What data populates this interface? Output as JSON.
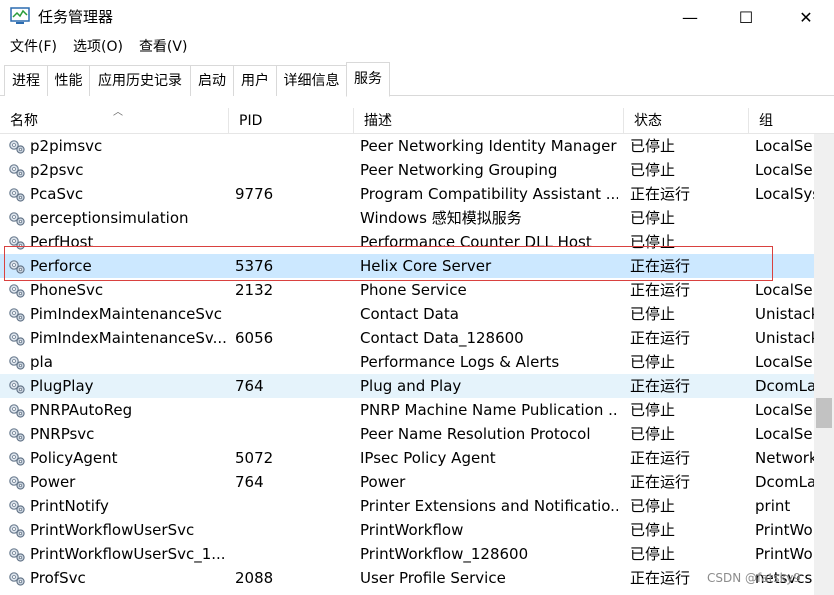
{
  "window": {
    "title": "任务管理器",
    "minimize": "—",
    "maximize": "☐",
    "close": "✕"
  },
  "menu": {
    "items": [
      "文件(F)",
      "选项(O)",
      "查看(V)"
    ]
  },
  "tabs": [
    "进程",
    "性能",
    "应用历史记录",
    "启动",
    "用户",
    "详细信息",
    "服务"
  ],
  "active_tab": "服务",
  "columns": {
    "name": "名称",
    "pid": "PID",
    "desc": "描述",
    "status": "状态",
    "group": "组"
  },
  "services": [
    {
      "name": "p2pimsvc",
      "pid": "",
      "desc": "Peer Networking Identity Manager",
      "status": "已停止",
      "group": "LocalSer"
    },
    {
      "name": "p2psvc",
      "pid": "",
      "desc": "Peer Networking Grouping",
      "status": "已停止",
      "group": "LocalSer"
    },
    {
      "name": "PcaSvc",
      "pid": "9776",
      "desc": "Program Compatibility Assistant ...",
      "status": "正在运行",
      "group": "LocalSys"
    },
    {
      "name": "perceptionsimulation",
      "pid": "",
      "desc": "Windows 感知模拟服务",
      "status": "已停止",
      "group": ""
    },
    {
      "name": "PerfHost",
      "pid": "",
      "desc": "Performance Counter DLL Host",
      "status": "已停止",
      "group": ""
    },
    {
      "name": "Perforce",
      "pid": "5376",
      "desc": "Helix Core Server",
      "status": "正在运行",
      "group": ""
    },
    {
      "name": "PhoneSvc",
      "pid": "2132",
      "desc": "Phone Service",
      "status": "正在运行",
      "group": "LocalSer"
    },
    {
      "name": "PimIndexMaintenanceSvc",
      "pid": "",
      "desc": "Contact Data",
      "status": "已停止",
      "group": "Unistack"
    },
    {
      "name": "PimIndexMaintenanceSv...",
      "pid": "6056",
      "desc": "Contact Data_128600",
      "status": "正在运行",
      "group": "Unistack"
    },
    {
      "name": "pla",
      "pid": "",
      "desc": "Performance Logs & Alerts",
      "status": "已停止",
      "group": "LocalSer"
    },
    {
      "name": "PlugPlay",
      "pid": "764",
      "desc": "Plug and Play",
      "status": "正在运行",
      "group": "DcomLa"
    },
    {
      "name": "PNRPAutoReg",
      "pid": "",
      "desc": "PNRP Machine Name Publication ...",
      "status": "已停止",
      "group": "LocalSer"
    },
    {
      "name": "PNRPsvc",
      "pid": "",
      "desc": "Peer Name Resolution Protocol",
      "status": "已停止",
      "group": "LocalSer"
    },
    {
      "name": "PolicyAgent",
      "pid": "5072",
      "desc": "IPsec Policy Agent",
      "status": "正在运行",
      "group": "Network"
    },
    {
      "name": "Power",
      "pid": "764",
      "desc": "Power",
      "status": "正在运行",
      "group": "DcomLa"
    },
    {
      "name": "PrintNotify",
      "pid": "",
      "desc": "Printer Extensions and Notificatio...",
      "status": "已停止",
      "group": "print"
    },
    {
      "name": "PrintWorkflowUserSvc",
      "pid": "",
      "desc": "PrintWorkflow",
      "status": "已停止",
      "group": "PrintWo"
    },
    {
      "name": "PrintWorkflowUserSvc_1...",
      "pid": "",
      "desc": "PrintWorkflow_128600",
      "status": "已停止",
      "group": "PrintWo"
    },
    {
      "name": "ProfSvc",
      "pid": "2088",
      "desc": "User Profile Service",
      "status": "正在运行",
      "group": "netsvcs"
    }
  ],
  "selected_service": "Perforce",
  "hovered_service": "PlugPlay",
  "watermark": "CSDN @fatsky9",
  "colors": {
    "selected": "#cce8ff",
    "hover": "#e5f3fb",
    "annotation": "#d9413f"
  },
  "icons": {
    "app": "task-manager-icon",
    "service": "gear-service-icon"
  }
}
